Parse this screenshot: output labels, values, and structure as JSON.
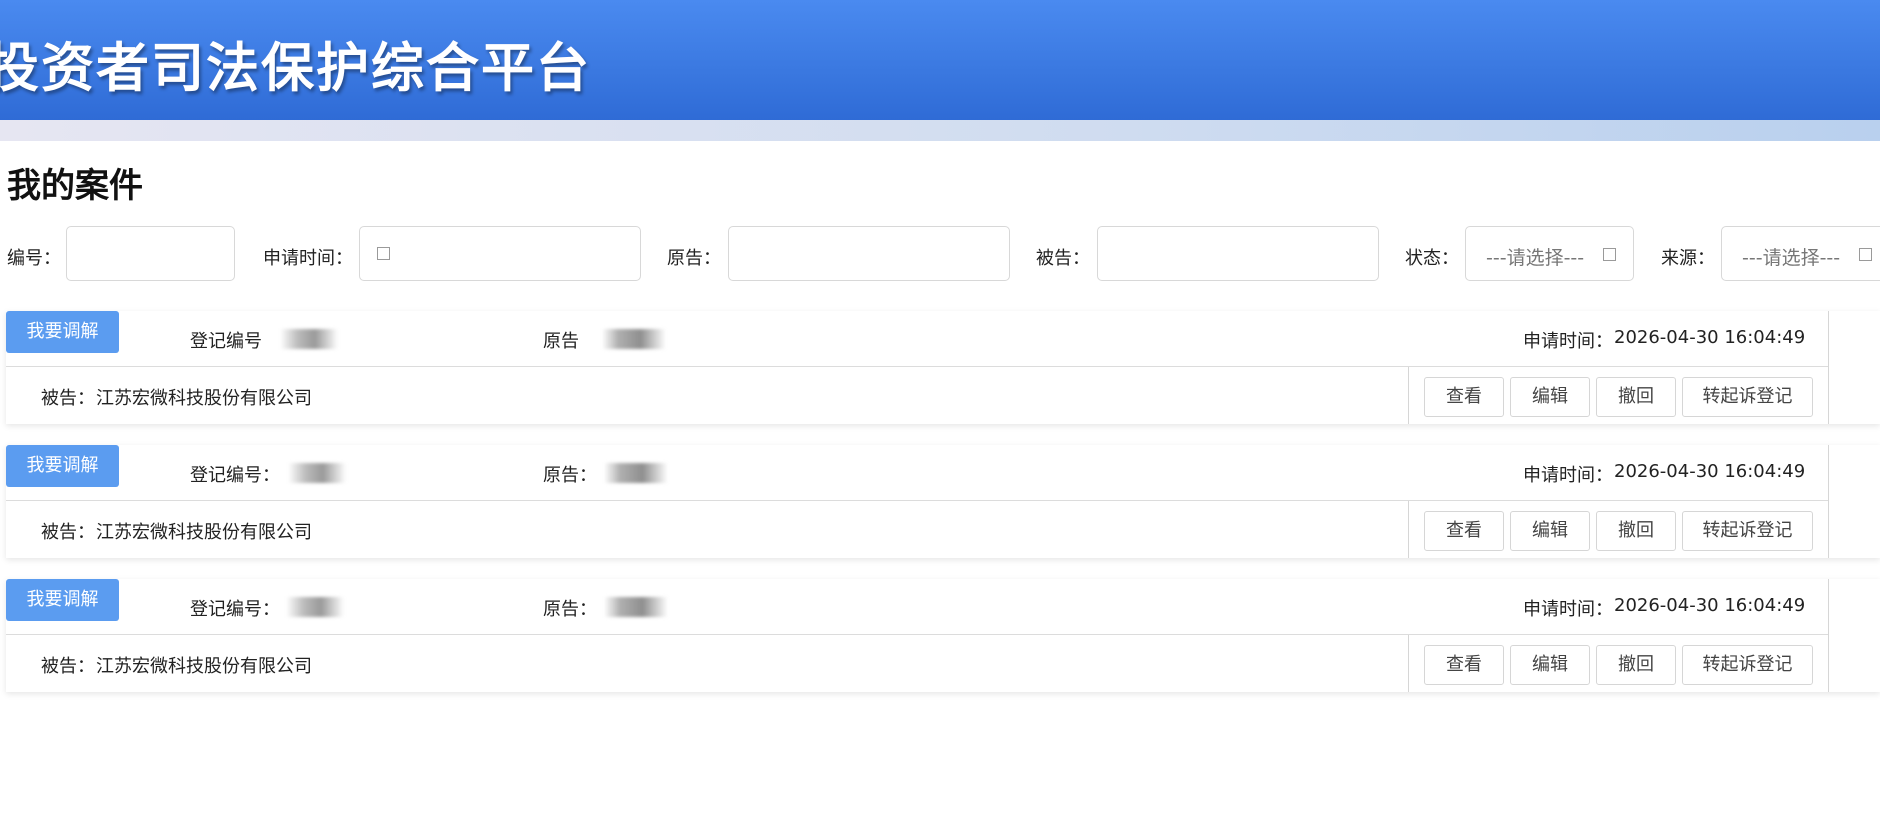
{
  "header": {
    "title": "投资者司法保护综合平台"
  },
  "page": {
    "title": "我的案件"
  },
  "filters": {
    "number_label": "编号：",
    "number_value": "",
    "apply_time_label": "申请时间：",
    "apply_time_value": "",
    "plaintiff_label": "原告：",
    "plaintiff_value": "",
    "defendant_label": "被告：",
    "defendant_value": "",
    "status_label": "状态：",
    "status_placeholder": "---请选择---",
    "source_label": "来源：",
    "source_placeholder": "---请选择---"
  },
  "cases": [
    {
      "mediate_label": "我要调解",
      "reg_no_label": "登记编号",
      "plaintiff_label": "原告",
      "apply_time_label": "申请时间：",
      "apply_time": "2026-04-30 16:04:49",
      "defendant_label": "被告：",
      "defendant": "江苏宏微科技股份有限公司",
      "actions": {
        "view": "查看",
        "edit": "编辑",
        "withdraw": "撤回",
        "to_litigation": "转起诉登记"
      }
    },
    {
      "mediate_label": "我要调解",
      "reg_no_label": "登记编号：",
      "plaintiff_label": "原告：",
      "apply_time_label": "申请时间：",
      "apply_time": "2026-04-30 16:04:49",
      "defendant_label": "被告：",
      "defendant": "江苏宏微科技股份有限公司",
      "actions": {
        "view": "查看",
        "edit": "编辑",
        "withdraw": "撤回",
        "to_litigation": "转起诉登记"
      }
    },
    {
      "mediate_label": "我要调解",
      "reg_no_label": "登记编号：",
      "plaintiff_label": "原告：",
      "apply_time_label": "申请时间：",
      "apply_time": "2026-04-30 16:04:49",
      "defendant_label": "被告：",
      "defendant": "江苏宏微科技股份有限公司",
      "actions": {
        "view": "查看",
        "edit": "编辑",
        "withdraw": "撤回",
        "to_litigation": "转起诉登记"
      }
    }
  ]
}
